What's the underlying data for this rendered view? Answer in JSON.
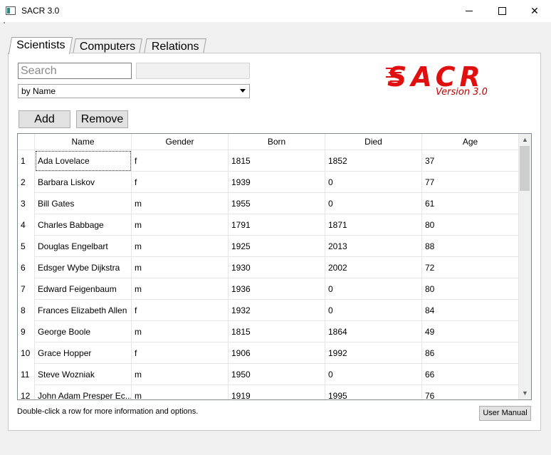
{
  "window": {
    "title": "SACR 3.0"
  },
  "tabs": [
    {
      "label": "Scientists"
    },
    {
      "label": "Computers"
    },
    {
      "label": "Relations"
    }
  ],
  "search": {
    "placeholder": "Search"
  },
  "sort_select": {
    "value": "by Name"
  },
  "buttons": {
    "add": "Add",
    "remove": "Remove",
    "user_manual": "User Manual"
  },
  "logo": {
    "text": "SACR",
    "version": "Version 3.0",
    "color": "#e01010"
  },
  "table": {
    "columns": [
      "Name",
      "Gender",
      "Born",
      "Died",
      "Age"
    ],
    "rows": [
      {
        "num": "1",
        "name": "Ada Lovelace",
        "gender": "f",
        "born": "1815",
        "died": "1852",
        "age": "37"
      },
      {
        "num": "2",
        "name": "Barbara Liskov",
        "gender": "f",
        "born": "1939",
        "died": "0",
        "age": "77"
      },
      {
        "num": "3",
        "name": "Bill Gates",
        "gender": "m",
        "born": "1955",
        "died": "0",
        "age": "61"
      },
      {
        "num": "4",
        "name": "Charles Babbage",
        "gender": "m",
        "born": "1791",
        "died": "1871",
        "age": "80"
      },
      {
        "num": "5",
        "name": "Douglas Engelbart",
        "gender": "m",
        "born": "1925",
        "died": "2013",
        "age": "88"
      },
      {
        "num": "6",
        "name": "Edsger Wybe Dijkstra",
        "gender": "m",
        "born": "1930",
        "died": "2002",
        "age": "72"
      },
      {
        "num": "7",
        "name": "Edward Feigenbaum",
        "gender": "m",
        "born": "1936",
        "died": "0",
        "age": "80"
      },
      {
        "num": "8",
        "name": "Frances Elizabeth Allen",
        "gender": "f",
        "born": "1932",
        "died": "0",
        "age": "84"
      },
      {
        "num": "9",
        "name": "George Boole",
        "gender": "m",
        "born": "1815",
        "died": "1864",
        "age": "49"
      },
      {
        "num": "10",
        "name": "Grace Hopper",
        "gender": "f",
        "born": "1906",
        "died": "1992",
        "age": "86"
      },
      {
        "num": "11",
        "name": "Steve Wozniak",
        "gender": "m",
        "born": "1950",
        "died": "0",
        "age": "66"
      },
      {
        "num": "12",
        "name": "John Adam Presper Ec...",
        "gender": "m",
        "born": "1919",
        "died": "1995",
        "age": "76"
      }
    ]
  },
  "status": {
    "hint": "Double-click a row for more information and options."
  }
}
